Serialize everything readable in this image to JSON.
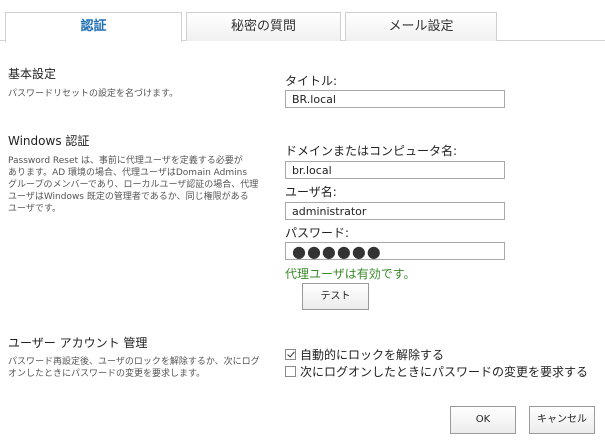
{
  "tabs": [
    {
      "label": "認証"
    },
    {
      "label": "秘密の質問"
    },
    {
      "label": "メール設定"
    }
  ],
  "basic": {
    "title": "基本設定",
    "desc": "パスワードリセットの設定を名づけます。",
    "title_label": "タイトル:",
    "title_value": "BR.local"
  },
  "windows_auth": {
    "title": "Windows 認証",
    "desc": [
      "Password Reset は、事前に代理ユーザを定義する必要が",
      "あります。AD 環境の場合、代理ユーザはDomain Admins",
      "グループのメンバーであり、ローカルユーザ認証の場合、代理",
      "ユーザはWindows 既定の管理者であるか、同じ権限がある",
      "ユーザです。"
    ],
    "domain_label": "ドメインまたはコンピュータ名:",
    "domain_value": "br.local",
    "user_label": "ユーザ名:",
    "user_value": "administrator",
    "password_label": "パスワード:",
    "password_mask": "●●●●●●",
    "status_text": "代理ユーザは有効です。",
    "test_button": "テスト"
  },
  "account": {
    "title": "ユーザー アカウント 管理",
    "desc": [
      "パスワード再設定後、ユーザのロックを解除するか、次にログ",
      "オンしたときにパスワードの変更を要求します。"
    ],
    "options": [
      {
        "label": "自動的にロックを解除する",
        "checked": true
      },
      {
        "label": "次にログオンしたときにパスワードの変更を要求する",
        "checked": false
      }
    ]
  },
  "footer": {
    "ok": "OK",
    "cancel": "キャンセル"
  },
  "colors": {
    "accent": "#1f6fb5",
    "success": "#3a8a2a"
  }
}
